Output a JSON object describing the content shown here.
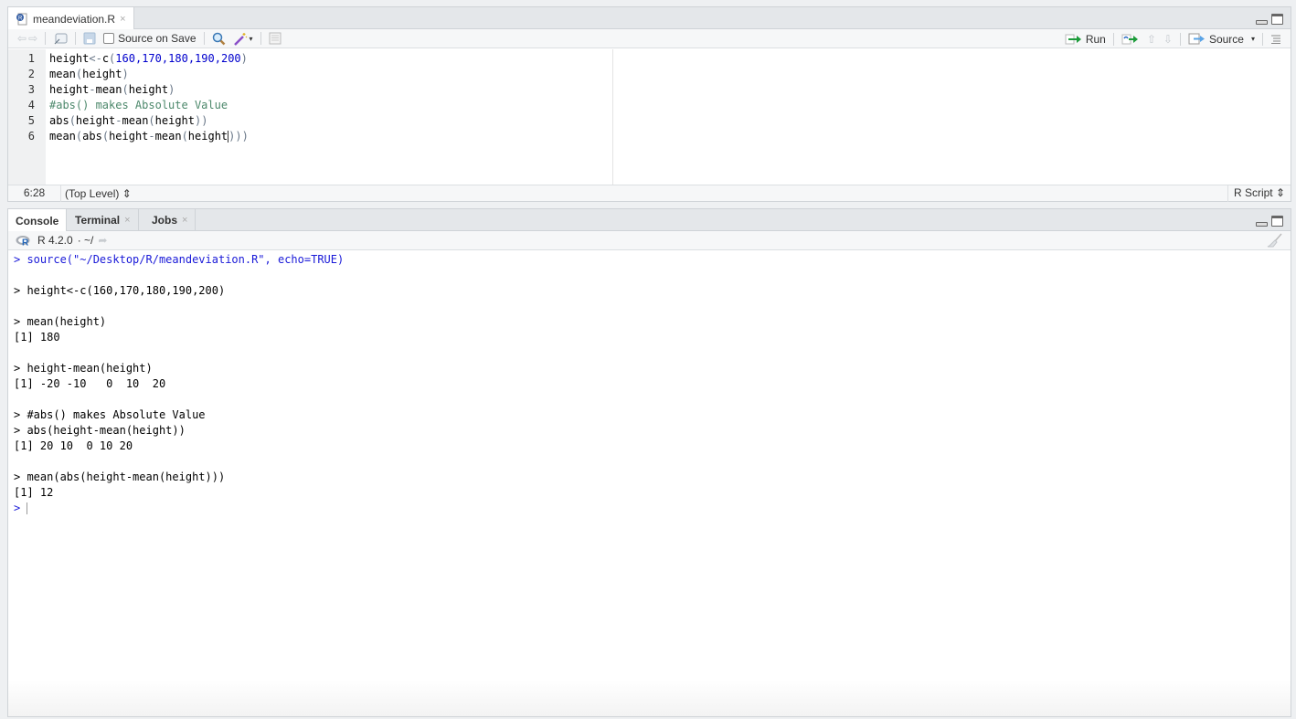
{
  "editor": {
    "tab": {
      "filename": "meandeviation.R",
      "close": "×"
    },
    "toolbar": {
      "source_on_save_label": "Source on Save",
      "source_on_save_checked": false,
      "run_label": "Run",
      "source_label": "Source"
    },
    "line_numbers": [
      "1",
      "2",
      "3",
      "4",
      "5",
      "6"
    ],
    "lines": [
      "height<-c(160,170,180,190,200)",
      "mean(height)",
      "height-mean(height)",
      "#abs() makes Absolute Value",
      "abs(height-mean(height))",
      "mean(abs(height-mean(height)))"
    ],
    "status": {
      "cursor_position": "6:28",
      "scope": "(Top Level) ⇕",
      "file_type": "R Script ⇕"
    }
  },
  "console": {
    "tabs": [
      {
        "label": "Console"
      },
      {
        "label": "Terminal",
        "close": "×"
      },
      {
        "label": "Jobs",
        "close": "×"
      }
    ],
    "r_version": "R 4.2.0",
    "working_dir": "· ~/",
    "output": [
      "> source(\"~/Desktop/R/meandeviation.R\", echo=TRUE)",
      "",
      "> height<-c(160,170,180,190,200)",
      "",
      "> mean(height)",
      "[1] 180",
      "",
      "> height-mean(height)",
      "[1] -20 -10   0  10  20",
      "",
      "> #abs() makes Absolute Value",
      "> abs(height-mean(height))",
      "[1] 20 10  0 10 20",
      "",
      "> mean(abs(height-mean(height)))",
      "[1] 12"
    ],
    "prompt": ">"
  }
}
